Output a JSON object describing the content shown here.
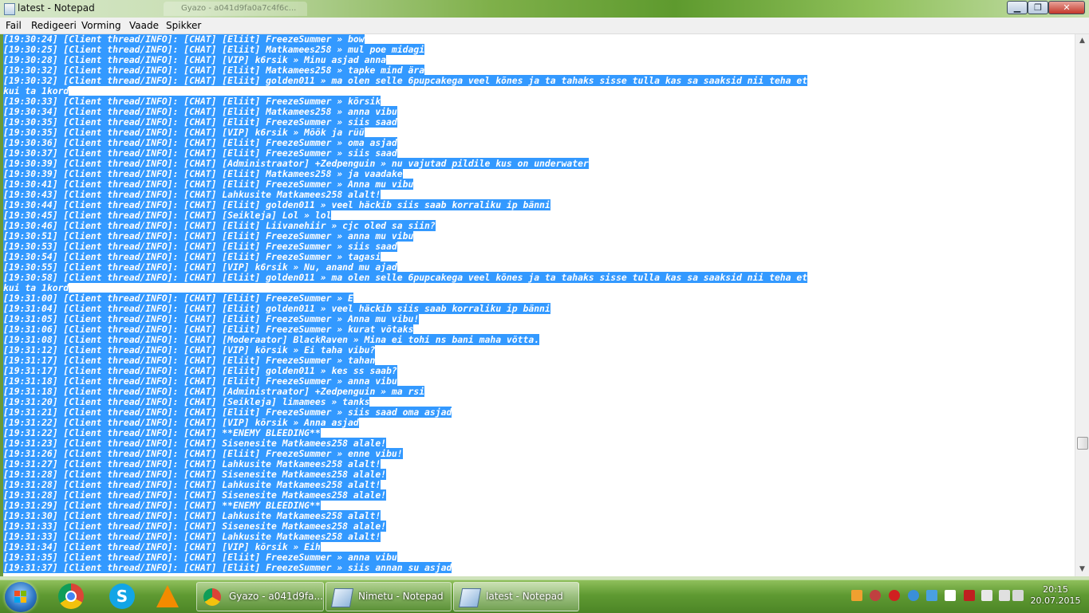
{
  "window": {
    "title": "latest - Notepad",
    "ghost_tab": "Gyazo - a041d9fa0a7c4f6c...",
    "min": "▁",
    "max": "❐",
    "close": "✕"
  },
  "menu": [
    "Fail",
    "Redigeeri",
    "Vorming",
    "Vaade",
    "Spikker"
  ],
  "log_lines": [
    "[19:30:24] [Client thread/INFO]: [CHAT] [Eliit] FreezeSummer » bow",
    "[19:30:25] [Client thread/INFO]: [CHAT] [Eliit] Matkamees258 » mul poe midagi",
    "[19:30:28] [Client thread/INFO]: [CHAT] [VIP] k6rsik » Minu asjad anna",
    "[19:30:32] [Client thread/INFO]: [CHAT] [Eliit] Matkamees258 » tapke mind ära",
    "[19:30:32] [Client thread/INFO]: [CHAT] [Eliit] golden011 » ma olen selle 6pupcakega veel kõnes ja ta tahaks sisse tulla kas sa saaksid nii teha et",
    "kui ta 1kord",
    "[19:30:33] [Client thread/INFO]: [CHAT] [Eliit] FreezeSummer » kõrsik",
    "[19:30:34] [Client thread/INFO]: [CHAT] [Eliit] Matkamees258 » anna vibu",
    "[19:30:35] [Client thread/INFO]: [CHAT] [Eliit] FreezeSummer » siis saad",
    "[19:30:35] [Client thread/INFO]: [CHAT] [VIP] k6rsik » Mõõk ja rüü",
    "[19:30:36] [Client thread/INFO]: [CHAT] [Eliit] FreezeSummer » oma asjad",
    "[19:30:37] [Client thread/INFO]: [CHAT] [Eliit] FreezeSummer » siis saad",
    "[19:30:39] [Client thread/INFO]: [CHAT] [Administraator] +Zedpenguin » nu vajutad pildile kus on underwater",
    "[19:30:39] [Client thread/INFO]: [CHAT] [Eliit] Matkamees258 » ja vaadake",
    "[19:30:41] [Client thread/INFO]: [CHAT] [Eliit] FreezeSummer » Anna mu vibu",
    "[19:30:43] [Client thread/INFO]: [CHAT] Lahkusite Matkamees258 alalt!",
    "[19:30:44] [Client thread/INFO]: [CHAT] [Eliit] golden011 » veel häckib siis saab korraliku ip bänni",
    "[19:30:45] [Client thread/INFO]: [CHAT] [Seikleja] Lol » lol",
    "[19:30:46] [Client thread/INFO]: [CHAT] [Eliit] Liivanehiir » cjc oled sa siin?",
    "[19:30:51] [Client thread/INFO]: [CHAT] [Eliit] FreezeSummer » anna mu vibu",
    "[19:30:53] [Client thread/INFO]: [CHAT] [Eliit] FreezeSummer » siis saad",
    "[19:30:54] [Client thread/INFO]: [CHAT] [Eliit] FreezeSummer » tagasi",
    "[19:30:55] [Client thread/INFO]: [CHAT] [VIP] k6rsik » Nu, anand mu ajad",
    "[19:30:58] [Client thread/INFO]: [CHAT] [Eliit] golden011 » ma olen selle 6pupcakega veel kõnes ja ta tahaks sisse tulla kas sa saaksid nii teha et",
    "kui ta 1kord",
    "[19:31:00] [Client thread/INFO]: [CHAT] [Eliit] FreezeSummer » E",
    "[19:31:04] [Client thread/INFO]: [CHAT] [Eliit] golden011 » veel häckib siis saab korraliku ip bänni",
    "[19:31:05] [Client thread/INFO]: [CHAT] [Eliit] FreezeSummer » Anna mu vibu!",
    "[19:31:06] [Client thread/INFO]: [CHAT] [Eliit] FreezeSummer » kurat võtaks",
    "[19:31:08] [Client thread/INFO]: [CHAT] [Moderaator] BlackRaven » Mina ei tohi ns bani maha võtta.",
    "[19:31:12] [Client thread/INFO]: [CHAT] [VIP] kõrsik » Ei taha vibu?",
    "[19:31:17] [Client thread/INFO]: [CHAT] [Eliit] FreezeSummer » tahan",
    "[19:31:17] [Client thread/INFO]: [CHAT] [Eliit] golden011 » kes ss saab?",
    "[19:31:18] [Client thread/INFO]: [CHAT] [Eliit] FreezeSummer » anna vibu",
    "[19:31:18] [Client thread/INFO]: [CHAT] [Administraator] +Zedpenguin » ma rsi",
    "[19:31:20] [Client thread/INFO]: [CHAT] [Seikleja] limamees » tanks",
    "[19:31:21] [Client thread/INFO]: [CHAT] [Eliit] FreezeSummer » siis saad oma asjad",
    "[19:31:22] [Client thread/INFO]: [CHAT] [VIP] kõrsik » Anna asjad",
    "[19:31:22] [Client thread/INFO]: [CHAT] **ENEMY BLEEDING**",
    "[19:31:23] [Client thread/INFO]: [CHAT] Sisenesite Matkamees258 alale!",
    "[19:31:26] [Client thread/INFO]: [CHAT] [Eliit] FreezeSummer » enne vibu!",
    "[19:31:27] [Client thread/INFO]: [CHAT] Lahkusite Matkamees258 alalt!",
    "[19:31:28] [Client thread/INFO]: [CHAT] Sisenesite Matkamees258 alale!",
    "[19:31:28] [Client thread/INFO]: [CHAT] Lahkusite Matkamees258 alalt!",
    "[19:31:28] [Client thread/INFO]: [CHAT] Sisenesite Matkamees258 alale!",
    "[19:31:29] [Client thread/INFO]: [CHAT] **ENEMY BLEEDING**",
    "[19:31:30] [Client thread/INFO]: [CHAT] Lahkusite Matkamees258 alalt!",
    "[19:31:33] [Client thread/INFO]: [CHAT] Sisenesite Matkamees258 alale!",
    "[19:31:33] [Client thread/INFO]: [CHAT] Lahkusite Matkamees258 alalt!",
    "[19:31:34] [Client thread/INFO]: [CHAT] [VIP] kõrsik » Eih",
    "[19:31:35] [Client thread/INFO]: [CHAT] [Eliit] FreezeSummer » anna vibu",
    "[19:31:37] [Client thread/INFO]: [CHAT] [Eliit] FreezeSummer » siis annan su asjad"
  ],
  "scrollbar": {
    "up": "▲",
    "down": "▼",
    "position": 0.8
  },
  "taskbar": {
    "pinned": [
      "chrome-icon",
      "skype-icon",
      "vlc-icon"
    ],
    "tasks": [
      {
        "label": "Gyazo - a041d9fa...",
        "icon": "chrome-icon"
      },
      {
        "label": "Nimetu - Notepad",
        "icon": "notepad-icon"
      },
      {
        "label": "latest - Notepad",
        "icon": "notepad-icon",
        "active": true
      }
    ],
    "skype_letter": "S",
    "clock_time": "20:15",
    "clock_date": "20.07.2015"
  },
  "colors": {
    "selection": "#3399ff",
    "taskbar": "#5f9a32"
  }
}
